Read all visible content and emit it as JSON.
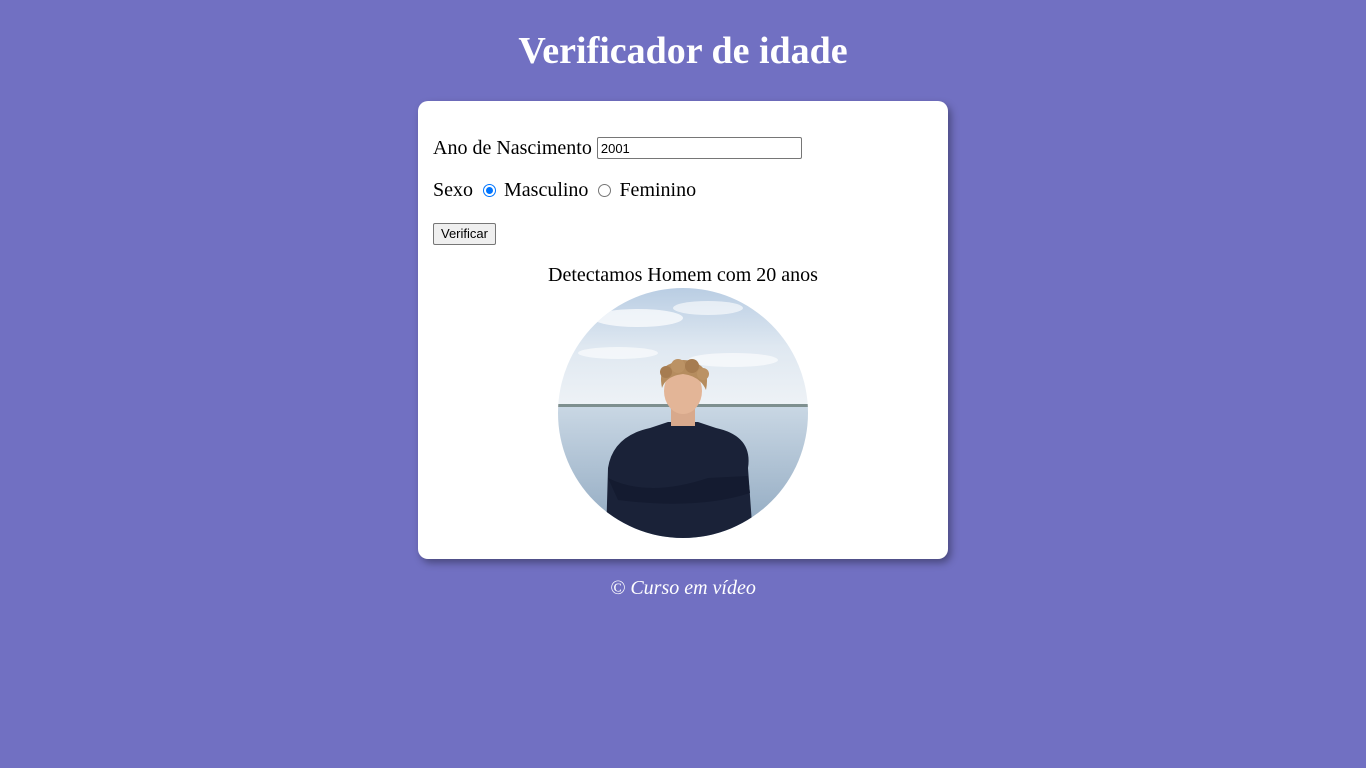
{
  "header": {
    "title": "Verificador de idade"
  },
  "form": {
    "year_label": "Ano de Nascimento",
    "year_value": "2001",
    "sex_label": "Sexo",
    "options": [
      {
        "label": "Masculino",
        "checked": true
      },
      {
        "label": "Feminino",
        "checked": false
      }
    ],
    "button_label": "Verificar"
  },
  "result": {
    "text": "Detectamos Homem com 20 anos",
    "image_icon": "person-photo"
  },
  "footer": {
    "text": "© Curso em vídeo"
  },
  "colors": {
    "background": "#7170c2",
    "card": "#ffffff",
    "radio_accent": "#0075ff"
  }
}
